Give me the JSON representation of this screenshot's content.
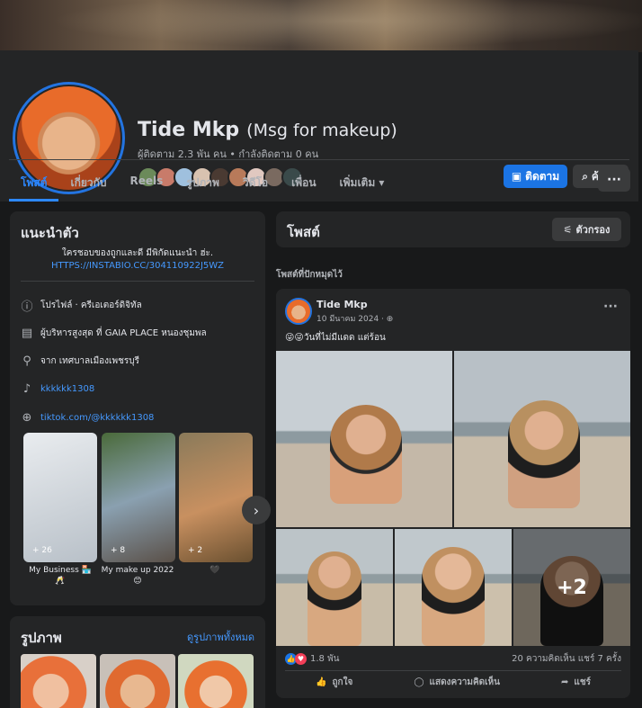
{
  "profile": {
    "name": "Tide Mkp",
    "subtitle": "(Msg for makeup)",
    "followers": "ผู้ติดตาม 2.3 พัน คน • กำลังติดตาม 0 คน",
    "follow_label": "ติดตาม",
    "search_label": "ค้นหา"
  },
  "tabs": [
    "โพสต์",
    "เกี่ยวกับ",
    "Reels",
    "รูปภาพ",
    "วิดีโอ",
    "เพื่อน",
    "เพิ่มเติม ▾"
  ],
  "more_label": "···",
  "intro": {
    "title": "แนะนำตัว",
    "bio": "ใครชอบของถูกและดี มีพิกัดแนะนำ ฮ่ะ.",
    "bio_link": "HTTPS://INSTABIO.CC/304110922J5WZ",
    "items": [
      {
        "icon": "info-icon",
        "text": "โปรไฟล์ · ครีเอเตอร์ดิจิทัล"
      },
      {
        "icon": "briefcase-icon",
        "text": "ผู้บริหารสูงสุด ที่ GAIA PLACE หนองชุมพล"
      },
      {
        "icon": "location-icon",
        "text": "จาก เทศบาลเมืองเพชรบุรี"
      },
      {
        "icon": "tiktok-icon",
        "text": "kkkkkk1308"
      },
      {
        "icon": "globe-icon",
        "text": "tiktok.com/@kkkkkk1308"
      }
    ],
    "highlights": [
      {
        "label": "My Business 🏪\n🥂",
        "count": "+ 26"
      },
      {
        "label": "My make up 2022\n😊",
        "count": "+ 8"
      },
      {
        "label": "🖤",
        "count": "+ 2"
      }
    ]
  },
  "photos": {
    "title": "รูปภาพ",
    "see_all": "ดูรูปภาพทั้งหมด"
  },
  "posts": {
    "title": "โพสต์",
    "filter_label": "ตัวกรอง",
    "pinned_label": "โพสต์ที่ปักหมุดไว้"
  },
  "post": {
    "author": "Tide Mkp",
    "date": "10 มีนาคม 2024 ·",
    "text": "😜😜วันที่ไม่มีแดด แต่ร้อน",
    "more_count": "+2",
    "reactions": "1.8 พัน",
    "comments_shares": "20 ความคิดเห็น  แชร์ 7 ครั้ง",
    "like_label": "ถูกใจ",
    "comment_label": "แสดงความคิดเห็น",
    "share_label": "แชร์"
  },
  "colors": {
    "accent": "#1b74e4",
    "background": "#18191a",
    "card": "#242526"
  }
}
